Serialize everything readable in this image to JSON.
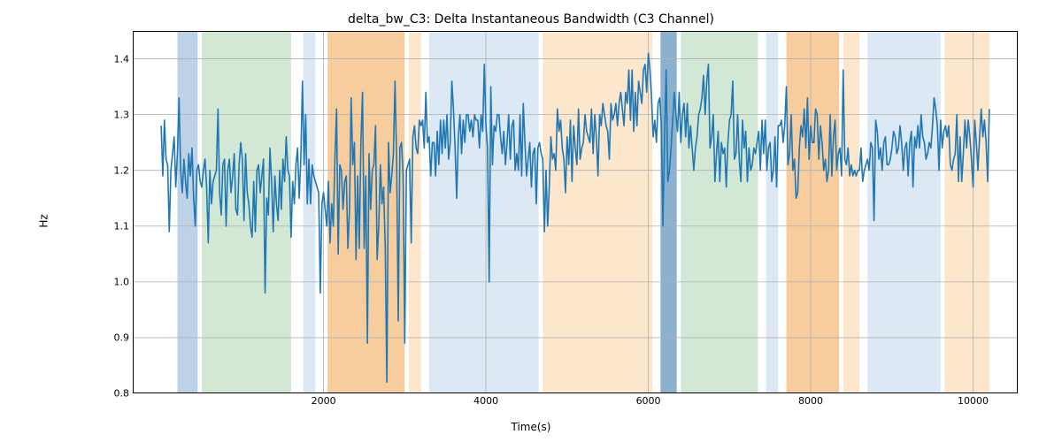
{
  "chart_data": {
    "type": "line",
    "title": "delta_bw_C3: Delta Instantaneous Bandwidth (C3 Channel)",
    "xlabel": "Time(s)",
    "ylabel": "Hz",
    "xlim": [
      -350,
      10550
    ],
    "ylim": [
      0.8,
      1.45
    ],
    "xticks": [
      2000,
      4000,
      6000,
      8000,
      10000
    ],
    "yticks": [
      0.8,
      0.9,
      1.0,
      1.1,
      1.2,
      1.3,
      1.4
    ],
    "line_color": "#1f77b4",
    "grid_color": "#b0b0b0",
    "spans": [
      {
        "x0": 200,
        "x1": 450,
        "color": "#b6cde3"
      },
      {
        "x0": 500,
        "x1": 1600,
        "color": "#cde6cf"
      },
      {
        "x0": 1750,
        "x1": 1900,
        "color": "#d8e5f2"
      },
      {
        "x0": 2050,
        "x1": 3000,
        "color": "#f6c894"
      },
      {
        "x0": 3050,
        "x1": 3200,
        "color": "#fce3c7"
      },
      {
        "x0": 3300,
        "x1": 4650,
        "color": "#d8e5f2"
      },
      {
        "x0": 4700,
        "x1": 6050,
        "color": "#fce3c7"
      },
      {
        "x0": 6150,
        "x1": 6350,
        "color": "#7fa8c9"
      },
      {
        "x0": 6400,
        "x1": 7350,
        "color": "#cde6cf"
      },
      {
        "x0": 7450,
        "x1": 7600,
        "color": "#d8e5f2"
      },
      {
        "x0": 7700,
        "x1": 8350,
        "color": "#f6c894"
      },
      {
        "x0": 8400,
        "x1": 8600,
        "color": "#fce3c7"
      },
      {
        "x0": 8700,
        "x1": 9600,
        "color": "#d8e5f2"
      },
      {
        "x0": 9650,
        "x1": 10200,
        "color": "#fce3c7"
      }
    ],
    "x": [
      0,
      20,
      40,
      60,
      80,
      100,
      120,
      140,
      160,
      180,
      200,
      220,
      240,
      260,
      280,
      300,
      320,
      340,
      360,
      380,
      400,
      420,
      440,
      460,
      480,
      500,
      520,
      540,
      560,
      580,
      600,
      620,
      640,
      660,
      680,
      700,
      720,
      740,
      760,
      780,
      800,
      820,
      840,
      860,
      880,
      900,
      920,
      940,
      960,
      980,
      1000,
      1020,
      1040,
      1060,
      1080,
      1100,
      1120,
      1140,
      1160,
      1180,
      1200,
      1220,
      1240,
      1260,
      1280,
      1300,
      1320,
      1340,
      1360,
      1380,
      1400,
      1420,
      1440,
      1460,
      1480,
      1500,
      1520,
      1540,
      1560,
      1580,
      1600,
      1620,
      1640,
      1660,
      1680,
      1700,
      1720,
      1740,
      1760,
      1780,
      1800,
      1820,
      1840,
      1860,
      1880,
      1900,
      1920,
      1940,
      1960,
      1980,
      2000,
      2020,
      2040,
      2060,
      2080,
      2100,
      2120,
      2140,
      2160,
      2180,
      2200,
      2220,
      2240,
      2260,
      2280,
      2300,
      2320,
      2340,
      2360,
      2380,
      2400,
      2420,
      2440,
      2460,
      2480,
      2500,
      2520,
      2540,
      2560,
      2580,
      2600,
      2620,
      2640,
      2660,
      2680,
      2700,
      2720,
      2740,
      2760,
      2780,
      2800,
      2820,
      2840,
      2860,
      2880,
      2900,
      2920,
      2940,
      2960,
      2980,
      3000,
      3020,
      3040,
      3060,
      3080,
      3100,
      3120,
      3140,
      3160,
      3180,
      3200,
      3220,
      3240,
      3260,
      3280,
      3300,
      3320,
      3340,
      3360,
      3380,
      3400,
      3420,
      3440,
      3460,
      3480,
      3500,
      3520,
      3540,
      3560,
      3580,
      3600,
      3620,
      3640,
      3660,
      3680,
      3700,
      3720,
      3740,
      3760,
      3780,
      3800,
      3820,
      3840,
      3860,
      3880,
      3900,
      3920,
      3940,
      3960,
      3980,
      4000,
      4020,
      4040,
      4060,
      4080,
      4100,
      4120,
      4140,
      4160,
      4180,
      4200,
      4220,
      4240,
      4260,
      4280,
      4300,
      4320,
      4340,
      4360,
      4380,
      4400,
      4420,
      4440,
      4460,
      4480,
      4500,
      4520,
      4540,
      4560,
      4580,
      4600,
      4620,
      4640,
      4660,
      4680,
      4700,
      4720,
      4740,
      4760,
      4780,
      4800,
      4820,
      4840,
      4860,
      4880,
      4900,
      4920,
      4940,
      4960,
      4980,
      5000,
      5020,
      5040,
      5060,
      5080,
      5100,
      5120,
      5140,
      5160,
      5180,
      5200,
      5220,
      5240,
      5260,
      5280,
      5300,
      5320,
      5340,
      5360,
      5380,
      5400,
      5420,
      5440,
      5460,
      5480,
      5500,
      5520,
      5540,
      5560,
      5580,
      5600,
      5620,
      5640,
      5660,
      5680,
      5700,
      5720,
      5740,
      5760,
      5780,
      5800,
      5820,
      5840,
      5860,
      5880,
      5900,
      5920,
      5940,
      5960,
      5980,
      6000,
      6020,
      6040,
      6060,
      6080,
      6100,
      6120,
      6140,
      6160,
      6180,
      6200,
      6220,
      6240,
      6260,
      6280,
      6300,
      6320,
      6340,
      6360,
      6380,
      6400,
      6420,
      6440,
      6460,
      6480,
      6500,
      6520,
      6540,
      6560,
      6580,
      6600,
      6620,
      6640,
      6660,
      6680,
      6700,
      6720,
      6740,
      6760,
      6780,
      6800,
      6820,
      6840,
      6860,
      6880,
      6900,
      6920,
      6940,
      6960,
      6980,
      7000,
      7020,
      7040,
      7060,
      7080,
      7100,
      7120,
      7140,
      7160,
      7180,
      7200,
      7220,
      7240,
      7260,
      7280,
      7300,
      7320,
      7340,
      7360,
      7380,
      7400,
      7420,
      7440,
      7460,
      7480,
      7500,
      7520,
      7540,
      7560,
      7580,
      7600,
      7620,
      7640,
      7660,
      7680,
      7700,
      7720,
      7740,
      7760,
      7780,
      7800,
      7820,
      7840,
      7860,
      7880,
      7900,
      7920,
      7940,
      7960,
      7980,
      8000,
      8020,
      8040,
      8060,
      8080,
      8100,
      8120,
      8140,
      8160,
      8180,
      8200,
      8220,
      8240,
      8260,
      8280,
      8300,
      8320,
      8340,
      8360,
      8380,
      8400,
      8420,
      8440,
      8460,
      8480,
      8500,
      8520,
      8540,
      8560,
      8580,
      8600,
      8620,
      8640,
      8660,
      8680,
      8700,
      8720,
      8740,
      8760,
      8780,
      8800,
      8820,
      8840,
      8860,
      8880,
      8900,
      8920,
      8940,
      8960,
      8980,
      9000,
      9020,
      9040,
      9060,
      9080,
      9100,
      9120,
      9140,
      9160,
      9180,
      9200,
      9220,
      9240,
      9260,
      9280,
      9300,
      9320,
      9340,
      9360,
      9380,
      9400,
      9420,
      9440,
      9460,
      9480,
      9500,
      9520,
      9540,
      9560,
      9580,
      9600,
      9620,
      9640,
      9660,
      9680,
      9700,
      9720,
      9740,
      9760,
      9780,
      9800,
      9820,
      9840,
      9860,
      9880,
      9900,
      9920,
      9940,
      9960,
      9980,
      10000,
      10020,
      10040,
      10060,
      10080,
      10100,
      10120,
      10140,
      10160,
      10180,
      10200
    ],
    "y": [
      1.28,
      1.19,
      1.29,
      1.22,
      1.21,
      1.09,
      1.2,
      1.23,
      1.26,
      1.17,
      1.23,
      1.33,
      1.2,
      1.16,
      1.22,
      1.18,
      1.15,
      1.23,
      1.19,
      1.24,
      1.15,
      1.1,
      1.2,
      1.21,
      1.18,
      1.17,
      1.2,
      1.22,
      1.17,
      1.07,
      1.2,
      1.14,
      1.18,
      1.19,
      1.2,
      1.31,
      1.16,
      1.12,
      1.21,
      1.22,
      1.1,
      1.2,
      1.22,
      1.16,
      1.19,
      1.23,
      1.13,
      1.12,
      1.21,
      1.25,
      1.22,
      1.11,
      1.23,
      1.16,
      1.14,
      1.1,
      1.08,
      1.18,
      1.09,
      1.2,
      1.21,
      1.16,
      1.19,
      1.22,
      0.98,
      1.15,
      1.12,
      1.24,
      1.18,
      1.09,
      1.19,
      1.14,
      1.11,
      1.2,
      1.13,
      1.22,
      1.18,
      1.26,
      1.2,
      1.19,
      1.08,
      1.18,
      1.14,
      1.21,
      1.24,
      1.15,
      1.22,
      1.36,
      1.21,
      1.3,
      1.14,
      1.22,
      1.14,
      1.21,
      1.19,
      1.18,
      1.17,
      1.16,
      0.98,
      1.14,
      1.16,
      1.13,
      1.1,
      1.18,
      1.07,
      1.14,
      1.1,
      1.22,
      1.31,
      1.05,
      1.21,
      1.2,
      1.13,
      1.18,
      1.19,
      1.06,
      1.13,
      1.33,
      1.21,
      1.25,
      1.04,
      1.19,
      1.06,
      1.25,
      1.34,
      1.06,
      1.19,
      0.89,
      1.23,
      1.13,
      1.2,
      1.21,
      1.28,
      1.04,
      1.1,
      1.21,
      1.14,
      1.17,
      1.06,
      0.82,
      1.25,
      1.16,
      1.19,
      1.23,
      1.36,
      1.22,
      0.93,
      1.24,
      1.25,
      1.19,
      0.89,
      1.2,
      1.21,
      1.22,
      1.07,
      1.26,
      1.28,
      1.24,
      1.23,
      1.29,
      1.28,
      1.29,
      1.24,
      1.34,
      1.25,
      1.26,
      1.19,
      1.25,
      1.25,
      1.19,
      1.27,
      1.21,
      1.29,
      1.23,
      1.29,
      1.24,
      1.3,
      1.22,
      1.25,
      1.36,
      1.31,
      1.24,
      1.15,
      1.26,
      1.3,
      1.23,
      1.29,
      1.25,
      1.3,
      1.3,
      1.27,
      1.29,
      1.26,
      1.3,
      1.29,
      1.29,
      1.24,
      1.3,
      1.27,
      1.39,
      1.28,
      1.24,
      1.0,
      1.35,
      1.21,
      1.28,
      1.27,
      1.3,
      1.3,
      1.26,
      1.23,
      1.27,
      1.21,
      1.25,
      1.3,
      1.22,
      1.28,
      1.29,
      1.2,
      1.23,
      1.2,
      1.3,
      1.19,
      1.32,
      1.25,
      1.19,
      1.22,
      1.25,
      1.17,
      1.23,
      1.24,
      1.14,
      1.24,
      1.25,
      1.23,
      1.22,
      1.09,
      1.2,
      1.1,
      1.17,
      1.26,
      1.22,
      1.23,
      1.2,
      1.31,
      1.27,
      1.29,
      1.24,
      1.22,
      1.16,
      1.26,
      1.21,
      1.29,
      1.18,
      1.28,
      1.24,
      1.21,
      1.31,
      1.22,
      1.24,
      1.25,
      1.3,
      1.27,
      1.26,
      1.25,
      1.31,
      1.23,
      1.3,
      1.26,
      1.19,
      1.3,
      1.28,
      1.32,
      1.3,
      1.28,
      1.27,
      1.22,
      1.32,
      1.29,
      1.3,
      1.32,
      1.28,
      1.32,
      1.34,
      1.31,
      1.28,
      1.34,
      1.32,
      1.38,
      1.29,
      1.38,
      1.27,
      1.34,
      1.28,
      1.36,
      1.34,
      1.32,
      1.38,
      1.39,
      1.34,
      1.41,
      1.38,
      1.33,
      1.26,
      1.29,
      1.25,
      1.32,
      1.33,
      1.28,
      1.1,
      1.26,
      1.38,
      1.18,
      1.2,
      1.24,
      1.29,
      1.34,
      1.3,
      1.27,
      1.34,
      1.25,
      1.3,
      1.32,
      1.26,
      1.32,
      1.24,
      1.28,
      1.24,
      1.2,
      1.24,
      1.26,
      1.3,
      1.31,
      1.33,
      1.37,
      1.3,
      1.36,
      1.39,
      1.24,
      1.26,
      1.3,
      1.18,
      1.23,
      1.27,
      1.18,
      1.25,
      1.23,
      1.24,
      1.17,
      1.25,
      1.29,
      1.3,
      1.36,
      1.22,
      1.23,
      1.3,
      1.22,
      1.18,
      1.29,
      1.24,
      1.27,
      1.18,
      1.24,
      1.2,
      1.21,
      1.24,
      1.23,
      1.25,
      1.27,
      1.2,
      1.29,
      1.23,
      1.29,
      1.2,
      1.24,
      1.25,
      1.18,
      1.2,
      1.26,
      1.17,
      1.28,
      1.28,
      1.29,
      1.25,
      1.28,
      1.35,
      1.21,
      1.23,
      1.3,
      1.2,
      1.22,
      1.15,
      1.16,
      1.24,
      1.28,
      1.26,
      1.31,
      1.24,
      1.33,
      1.22,
      1.28,
      1.25,
      1.25,
      1.31,
      1.3,
      1.22,
      1.28,
      1.25,
      1.2,
      1.22,
      1.18,
      1.2,
      1.3,
      1.19,
      1.26,
      1.29,
      1.2,
      1.23,
      1.24,
      1.19,
      1.38,
      1.22,
      1.21,
      1.24,
      1.19,
      1.21,
      1.19,
      1.2,
      1.19,
      1.2,
      1.2,
      1.24,
      1.18,
      1.2,
      1.21,
      1.22,
      1.2,
      1.25,
      1.24,
      1.11,
      1.29,
      1.27,
      1.22,
      1.24,
      1.2,
      1.25,
      1.26,
      1.21,
      1.21,
      1.22,
      1.24,
      1.27,
      1.26,
      1.23,
      1.24,
      1.28,
      1.25,
      1.2,
      1.24,
      1.25,
      1.19,
      1.25,
      1.27,
      1.17,
      1.26,
      1.24,
      1.28,
      1.24,
      1.3,
      1.26,
      1.25,
      1.22,
      1.23,
      1.25,
      1.24,
      1.28,
      1.33,
      1.31,
      1.28,
      1.2,
      1.29,
      1.24,
      1.27,
      1.28,
      1.26,
      1.28,
      1.21,
      1.2,
      1.22,
      1.23,
      1.3,
      1.18,
      1.26,
      1.18,
      1.23,
      1.29,
      1.24,
      1.29,
      1.26,
      1.22,
      1.17,
      1.29,
      1.25,
      1.2,
      1.26,
      1.31,
      1.26,
      1.29,
      1.25,
      1.18,
      1.31
    ]
  }
}
